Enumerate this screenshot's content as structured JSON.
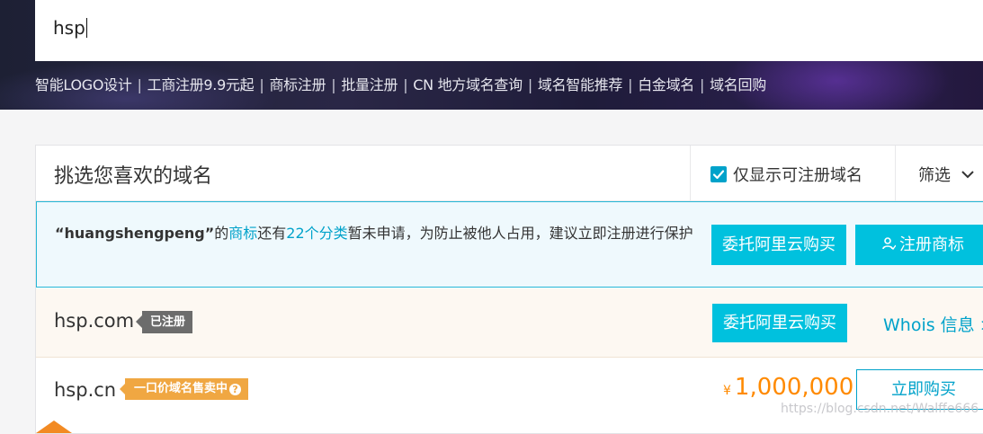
{
  "search": {
    "value": "hsp"
  },
  "quicklinks": [
    "智能LOGO设计",
    "工商注册9.9元起",
    "商标注册",
    "批量注册",
    "CN 地方域名查询",
    "域名智能推荐",
    "白金域名",
    "域名回购"
  ],
  "header": {
    "title": "挑选您喜欢的域名",
    "checkbox_label": "仅显示可注册域名",
    "checkbox_checked": true,
    "filter_label": "筛选"
  },
  "trademark": {
    "quote_name": "“huangshengpeng”",
    "text1": "的",
    "link1": "商标",
    "text2": "还有",
    "link2": "22个分类",
    "text3": "暂未申请，为防止被他人占用，建议立即注册进行保护",
    "entrust_button": "委托阿里云购买",
    "register_button": "注册商标"
  },
  "results": [
    {
      "domain": "hsp.com",
      "tag": "已注册",
      "action_button": "委托阿里云购买",
      "whois": "Whois 信息 >"
    },
    {
      "domain": "hsp.cn",
      "tag": "一口价域名售卖中",
      "currency": "¥",
      "price": "1,000,000",
      "action_button": "立即购买"
    }
  ],
  "watermark": "https://blog.csdn.net/Walffe666",
  "colors": {
    "accent": "#00c1de",
    "link": "#00a2ca",
    "price": "#ff8a00",
    "sale_tag": "#f0a742"
  }
}
